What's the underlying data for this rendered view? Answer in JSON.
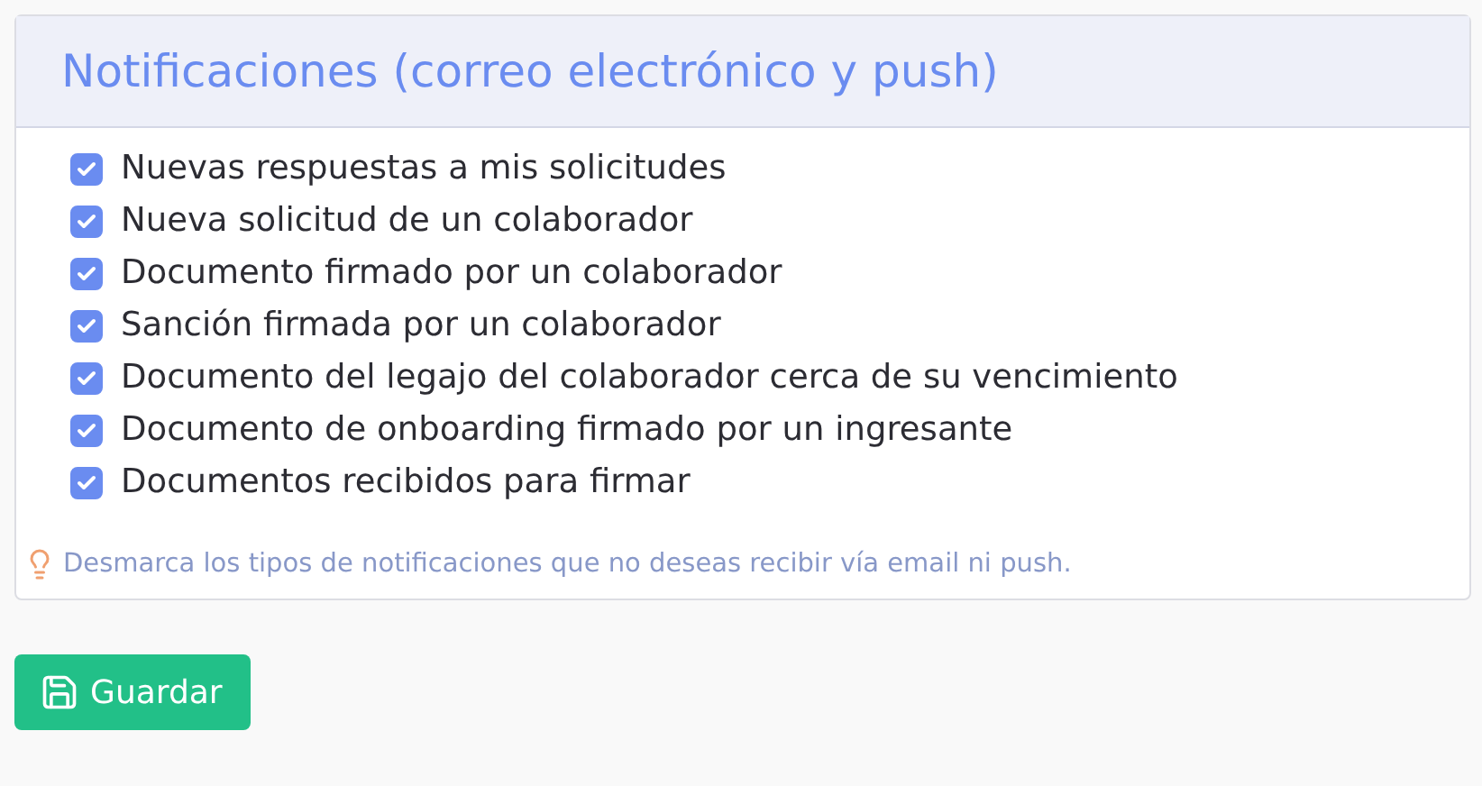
{
  "card": {
    "title": "Notificaciones (correo electrónico y push)",
    "options": [
      {
        "label": "Nuevas respuestas a mis solicitudes",
        "checked": true
      },
      {
        "label": "Nueva solicitud de un colaborador",
        "checked": true
      },
      {
        "label": "Documento firmado por un colaborador",
        "checked": true
      },
      {
        "label": "Sanción firmada por un colaborador",
        "checked": true
      },
      {
        "label": "Documento del legajo del colaborador cerca de su vencimiento",
        "checked": true
      },
      {
        "label": "Documento de onboarding firmado por un ingresante",
        "checked": true
      },
      {
        "label": "Documentos recibidos para firmar",
        "checked": true
      }
    ],
    "hint": "Desmarca los tipos de notificaciones que no deseas recibir vía email ni push."
  },
  "save_button": "Guardar"
}
